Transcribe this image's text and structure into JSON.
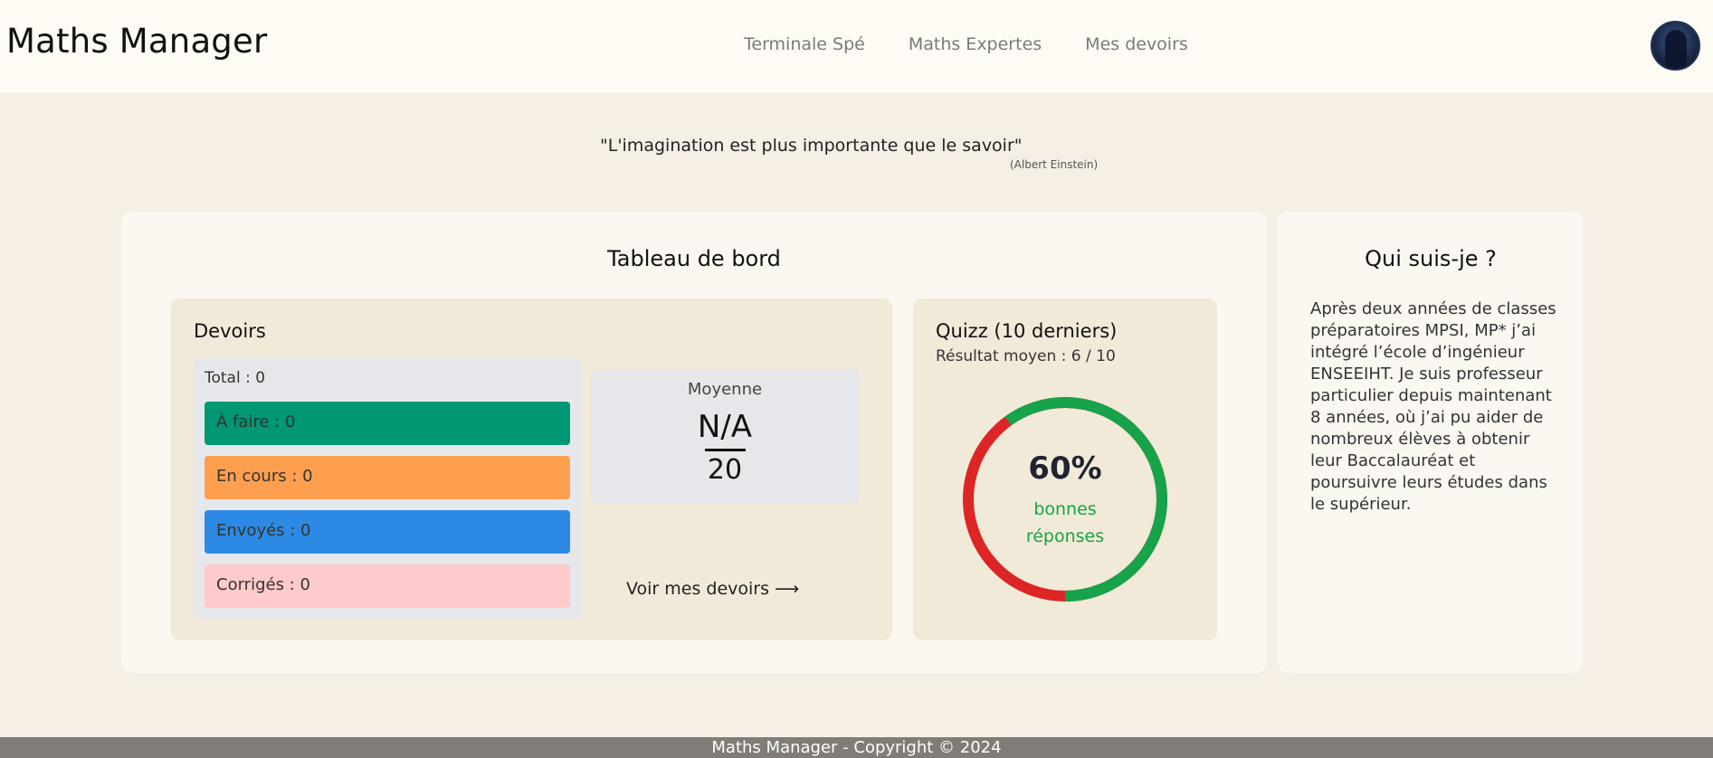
{
  "header": {
    "brand": "Maths Manager",
    "nav": [
      "Terminale Spé",
      "Maths Expertes",
      "Mes devoirs"
    ]
  },
  "quote": {
    "text": "\"L'imagination est plus importante que le savoir\"",
    "author": "(Albert Einstein)"
  },
  "dashboard": {
    "title": "Tableau de bord",
    "devoirs": {
      "title": "Devoirs",
      "total": "Total : 0",
      "stats": [
        {
          "label": "À faire : 0",
          "color": "#009775"
        },
        {
          "label": "En cours : 0",
          "color": "#fe9f50"
        },
        {
          "label": "Envoyés : 0",
          "color": "#2d8ae4"
        },
        {
          "label": "Corrigés : 0",
          "color": "#ffcacb"
        }
      ],
      "moyenne": {
        "label": "Moyenne",
        "numerator": "N/A",
        "denominator": "20"
      },
      "link": "Voir mes devoirs ⟶"
    },
    "quiz": {
      "title": "Quizz (10 derniers)",
      "subtitle": "Résultat moyen : 6 / 10",
      "percent": "60%",
      "percent_value": 60,
      "percent_label_line1": "bonnes",
      "percent_label_line2": "réponses",
      "colors": {
        "good": "#16a34a",
        "bad": "#dc2626"
      }
    }
  },
  "about": {
    "title": "Qui suis-je ?",
    "text": "Après deux années de classes préparatoires MPSI, MP* j’ai intégré l’école d’ingénieur ENSEEIHT. Je suis professeur particulier depuis maintenant 8 années, où j’ai pu aider de nombreux élèves à obtenir leur Baccalauréat et poursuivre leurs études dans le supérieur."
  },
  "footer": {
    "text": "Maths Manager - Copyright © 2024"
  }
}
